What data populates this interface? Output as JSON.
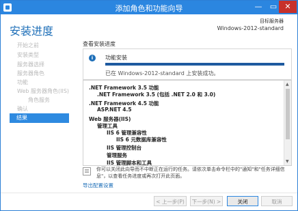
{
  "window": {
    "title": "添加角色和功能向导",
    "controls": [
      "—",
      "▭",
      "✕"
    ]
  },
  "header": {
    "page_title": "安装进度",
    "server_label": "目标服务器",
    "server_name": "Windows-2012-standard"
  },
  "sidebar": {
    "items": [
      {
        "label": "开始之前",
        "state": "disabled"
      },
      {
        "label": "安装类型",
        "state": "disabled"
      },
      {
        "label": "服务器选择",
        "state": "disabled"
      },
      {
        "label": "服务器角色",
        "state": "disabled"
      },
      {
        "label": "功能",
        "state": "disabled"
      },
      {
        "label": "Web 服务器角色(IIS)",
        "state": "disabled"
      },
      {
        "label": "角色服务",
        "state": "disabled",
        "sub": true
      },
      {
        "label": "确认",
        "state": "disabled"
      },
      {
        "label": "结果",
        "state": "active"
      }
    ]
  },
  "main": {
    "section_title": "查看安装进度",
    "progress": {
      "label": "功能安装",
      "value": 1.0,
      "status": "已在 Windows-2012-standard 上安装成功。"
    },
    "results": [
      {
        "text": ".NET Framework 3.5 功能",
        "level": 0
      },
      {
        "text": ".NET Framework 3.5 (包括 .NET 2.0 和 3.0)",
        "level": 1
      },
      {
        "text": ".NET Framework 4.5 功能",
        "level": 0
      },
      {
        "text": "ASP.NET 4.5",
        "level": 1
      },
      {
        "text": "Web 服务器(IIS)",
        "level": 0
      },
      {
        "text": "管理工具",
        "level": 1
      },
      {
        "text": "IIS 6 管理兼容性",
        "level": 2
      },
      {
        "text": "IIS 6 元数据库兼容性",
        "level": 3
      },
      {
        "text": "IIS 管理控制台",
        "level": 2
      },
      {
        "text": "管理服务",
        "level": 2
      },
      {
        "text": "IIS 管理脚本和工具",
        "level": 2
      }
    ],
    "note": "你可以关闭此向导而不中断正在运行的任务。请依次单击命令栏中的\"通知\"和\"任务详细信息\"，以查看任务进度或再次打开此页面。",
    "export_link": "导出配置设置"
  },
  "footer": {
    "prev_label": "< 上一步(P)",
    "next_label": "下一步(N) >",
    "close_label": "关闭",
    "cancel_label": "取消"
  },
  "colors": {
    "titlebar": "#2b86e0",
    "accent": "#1e6fb8",
    "active_nav": "#2e8ae0",
    "progress_fill": "#1e5aa0",
    "close_button": "#c7312b"
  },
  "icons": {
    "app": "server-manager-icon",
    "info": "info-icon",
    "note": "notes-icon"
  }
}
